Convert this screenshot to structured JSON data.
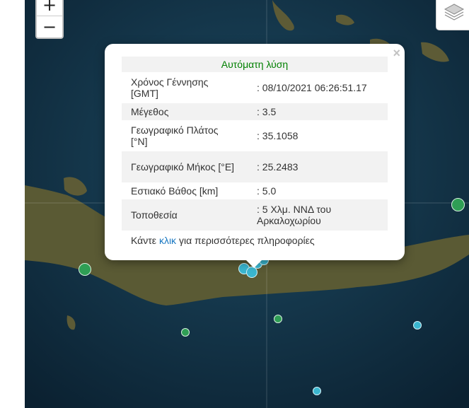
{
  "map": {
    "zoom_in_label": "+",
    "zoom_out_label": "−",
    "layers_icon": "layers-icon",
    "colors": {
      "sea": "#0f2a3c",
      "land": "#5a5a34",
      "marker_green": "#2f9e55",
      "marker_cyan": "#3ab6cf"
    }
  },
  "popup": {
    "close_label": "×",
    "header": "Αυτόματη λύση",
    "rows": [
      {
        "label": "Χρόνος Γέννησης [GMT]",
        "value": ": 08/10/2021 06:26:51.17"
      },
      {
        "label": "Μέγεθος",
        "value": ": 3.5"
      },
      {
        "label": "Γεωγραφικό Πλάτος [°N]",
        "value": ": 35.1058"
      },
      {
        "label": "Γεωγραφικό Μήκος [°E]",
        "value": ": 25.2483"
      },
      {
        "label": "Εστιακό Βάθος [km]",
        "value": ": 5.0"
      },
      {
        "label": "Τοποθεσία",
        "value": ": 5 Χλμ. ΝΝΔ του Αρκαλοχωρίου"
      }
    ],
    "more_prefix": "Κάντε",
    "more_link": "κλικ",
    "more_suffix": "για περισσότερες πληροφορίες"
  }
}
